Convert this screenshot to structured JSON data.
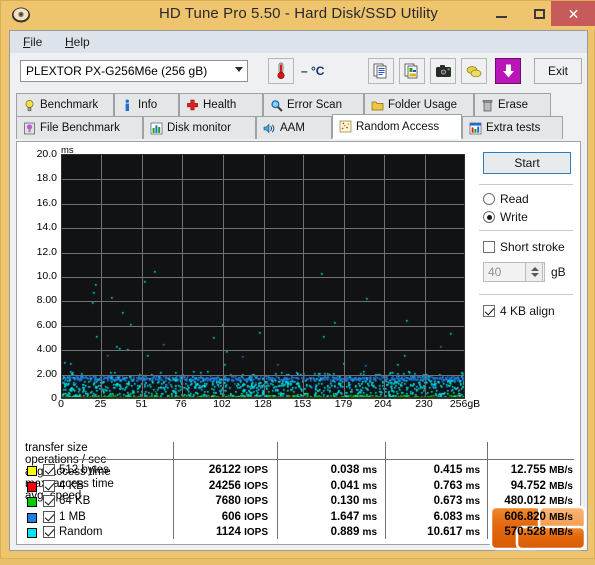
{
  "window": {
    "title": "HD Tune Pro 5.50 - Hard Disk/SSD Utility",
    "app_icon": "hard-disk-icon",
    "minimize_label": "–",
    "maximize_label": "□",
    "close_label": "✕",
    "close_color": "#c75b5b",
    "titlebar_color": "#eec46f"
  },
  "menu": {
    "items": [
      {
        "label": "File",
        "accel": "F"
      },
      {
        "label": "Help",
        "accel": "H"
      }
    ]
  },
  "toolbar": {
    "drive": "PLEXTOR PX-G256M6e (256 gB)",
    "temperature": "– °C",
    "thermo_icon": "thermometer-icon",
    "buttons": [
      {
        "name": "copy-text-icon"
      },
      {
        "name": "copy-image-icon"
      },
      {
        "name": "screenshot-camera-icon"
      },
      {
        "name": "coins-icon"
      },
      {
        "name": "download-arrow-icon"
      }
    ],
    "exit_label": "Exit"
  },
  "tabs": {
    "row1": [
      {
        "label": "Benchmark",
        "icon": "bulb-icon",
        "active": false
      },
      {
        "label": "Info",
        "icon": "info-icon",
        "active": false
      },
      {
        "label": "Health",
        "icon": "red-cross-icon",
        "active": false
      },
      {
        "label": "Error Scan",
        "icon": "magnifier-icon",
        "active": false
      },
      {
        "label": "Folder Usage",
        "icon": "folder-icon",
        "active": false
      },
      {
        "label": "Erase",
        "icon": "trash-icon",
        "active": false
      }
    ],
    "row2": [
      {
        "label": "File Benchmark",
        "icon": "file-bulb-icon",
        "active": false
      },
      {
        "label": "Disk monitor",
        "icon": "bar-chart-icon",
        "active": false
      },
      {
        "label": "AAM",
        "icon": "speaker-icon",
        "active": false
      },
      {
        "label": "Random Access",
        "icon": "scatter-icon",
        "active": true
      },
      {
        "label": "Extra tests",
        "icon": "grid-chart-icon",
        "active": false
      }
    ]
  },
  "controls": {
    "start_label": "Start",
    "mode_read": "Read",
    "mode_write": "Write",
    "mode_selected": "Write",
    "short_stroke_label": "Short stroke",
    "short_stroke_checked": false,
    "short_stroke_value": "40",
    "short_stroke_unit": "gB",
    "align_label": "4 KB align",
    "align_checked": true
  },
  "chart_data": {
    "type": "scatter",
    "title": "",
    "xlabel": "",
    "ylabel": "ms",
    "yunit": "ms",
    "xunit": "gB",
    "ylim": [
      0,
      20
    ],
    "xlim": [
      0,
      256
    ],
    "grid": true,
    "background": "#111214",
    "gridline_color": "#6f7174",
    "yticks": [
      "0",
      "2.00",
      "4.00",
      "6.00",
      "8.00",
      "10.0",
      "12.0",
      "14.0",
      "16.0",
      "18.0",
      "20.0"
    ],
    "ytick_values": [
      0,
      2,
      4,
      6,
      8,
      10,
      12,
      14,
      16,
      18,
      20
    ],
    "xticks": [
      "0",
      "25",
      "51",
      "76",
      "102",
      "128",
      "153",
      "179",
      "204",
      "230",
      "256gB"
    ],
    "xtick_values": [
      0,
      25,
      51,
      76,
      102,
      128,
      153,
      179,
      204,
      230,
      256
    ],
    "series": [
      {
        "name": "512 bytes",
        "color": "#ffff00",
        "mean_ms": 0.038,
        "max_ms": 0.415,
        "point_count": 340
      },
      {
        "name": "4 KB",
        "color": "#ff0000",
        "mean_ms": 0.041,
        "max_ms": 0.763,
        "point_count": 340
      },
      {
        "name": "64 KB",
        "color": "#00cc00",
        "mean_ms": 0.13,
        "max_ms": 0.673,
        "point_count": 340
      },
      {
        "name": "1 MB",
        "color": "#1e7fe8",
        "mean_ms": 1.647,
        "max_ms": 6.083,
        "point_count": 700
      },
      {
        "name": "Random",
        "color": "#00e5f0",
        "mean_ms": 0.889,
        "max_ms": 10.617,
        "point_count": 900
      }
    ]
  },
  "results": {
    "headers": [
      "transfer size",
      "operations / sec",
      "avg. access time",
      "max. access time",
      "avg. speed"
    ],
    "rows": [
      {
        "color": "#ffff00",
        "checked": true,
        "label": "512 bytes",
        "iops": "26122 IOPS",
        "avg_access": "0.038 ms",
        "max_access": "0.415 ms",
        "avg_speed": "12.755 MB/s"
      },
      {
        "color": "#ff0000",
        "checked": true,
        "label": "4 KB",
        "iops": "24256 IOPS",
        "avg_access": "0.041 ms",
        "max_access": "0.763 ms",
        "avg_speed": "94.752 MB/s"
      },
      {
        "color": "#00cc00",
        "checked": true,
        "label": "64 KB",
        "iops": "7680 IOPS",
        "avg_access": "0.130 ms",
        "max_access": "0.673 ms",
        "avg_speed": "480.012 MB/s"
      },
      {
        "color": "#1e7fe8",
        "checked": true,
        "label": "1 MB",
        "iops": "606 IOPS",
        "avg_access": "1.647 ms",
        "max_access": "6.083 ms",
        "avg_speed": "606.820 MB/s"
      },
      {
        "color": "#00e5f0",
        "checked": true,
        "label": "Random",
        "iops": "1124 IOPS",
        "avg_access": "0.889 ms",
        "max_access": "10.617 ms",
        "avg_speed": "570.528 MB/s"
      }
    ]
  },
  "watermark": {
    "name": "orange-logo",
    "color": "#e2660c"
  }
}
